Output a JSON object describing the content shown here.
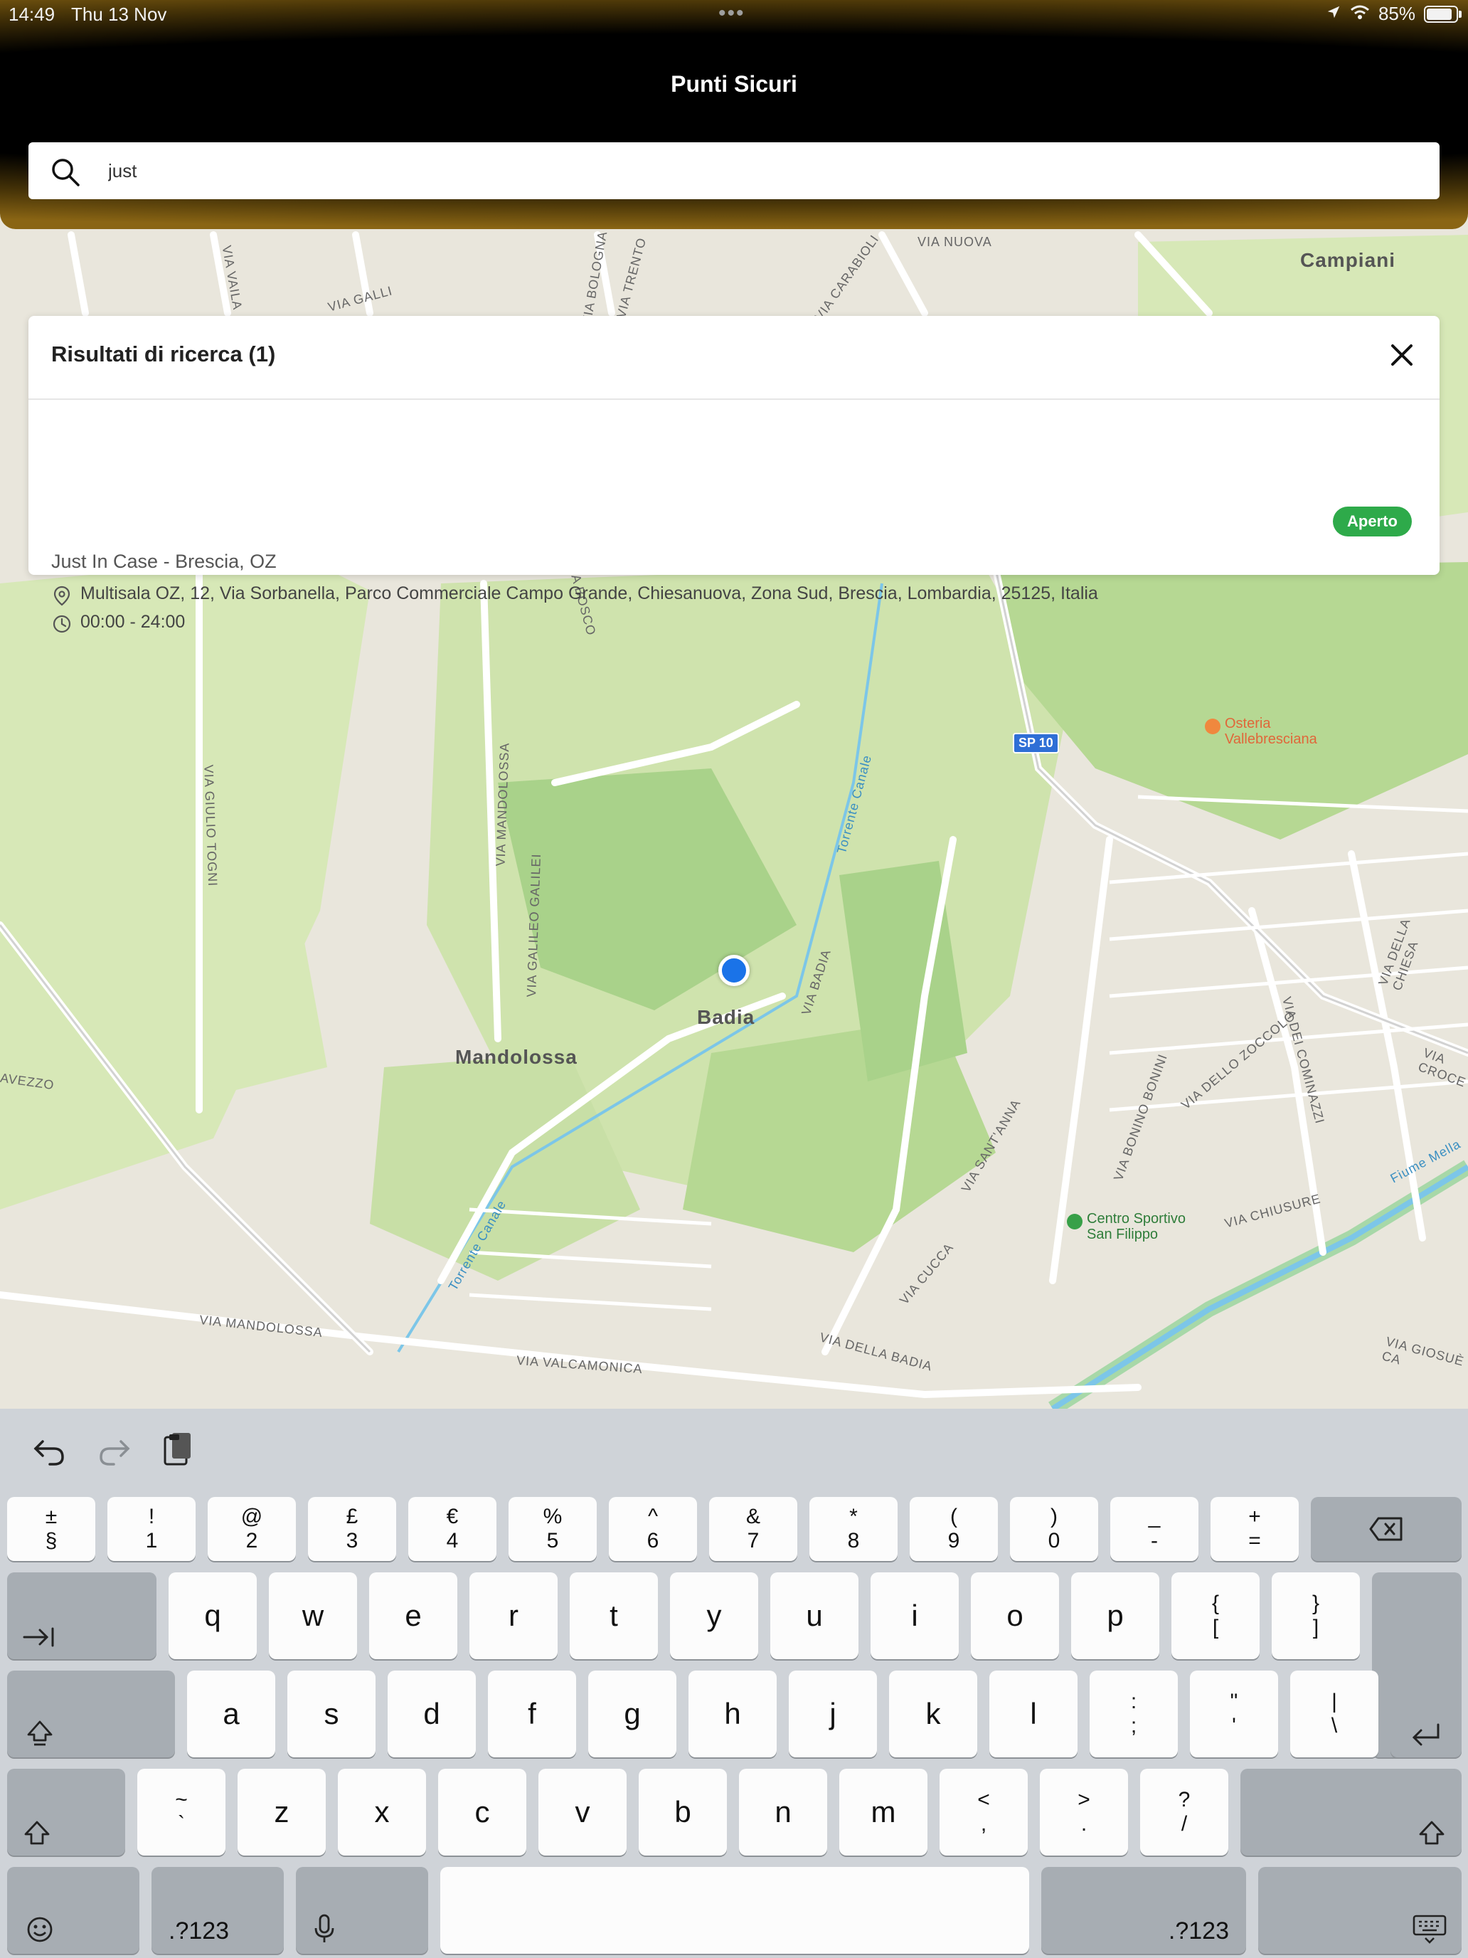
{
  "status_bar": {
    "time": "14:49",
    "date": "Thu 13 Nov",
    "battery": "85%"
  },
  "header": {
    "title": "Punti Sicuri"
  },
  "search": {
    "value": "just"
  },
  "results": {
    "title": "Risultati di ricerca (1)",
    "items": [
      {
        "status": "Aperto",
        "name": "Just In Case - Brescia, OZ",
        "address": "Multisala OZ, 12, Via Sorbanella, Parco Commerciale Campo Grande, Chiesanuova, Zona Sud, Brescia, Lombardia, 25125, Italia",
        "hours": "00:00 - 24:00"
      }
    ]
  },
  "map": {
    "places": [
      "Campiani",
      "Badia",
      "Mandolossa"
    ],
    "pois": [
      "Osteria\nVallebresciana",
      "Centro Sportivo\nSan Filippo"
    ],
    "shields": [
      "SP 10"
    ],
    "roads": [
      "VIA NUOVA",
      "VIA CARABIOLI",
      "VIA GALLI",
      "VIA MANDOLOSSA",
      "VIA GIULIO TOGNI",
      "VIA GALILEO GALILEI",
      "VIA BADIA",
      "Torrente Canale",
      "VIA MANDOLOSSA",
      "VIA VALCAMONICA",
      "VIA DELLA BADIA",
      "VIA CUCCA",
      "VIA SANT'ANNA",
      "VIA BONINO BONINI",
      "VIA DELLO ZOCCOLO",
      "VIA DEI COMINAZZI",
      "VIA DELLA CHIESA",
      "VIA CHIUSURE",
      "VIA CROCE",
      "Fiume Mella",
      "VIA GIOSUÈ CA",
      "Torrente Canale",
      "VIA VAILA",
      "VIA BOLOGNA",
      "VIA TRENTO",
      "AVEZZO",
      "A BOSCO"
    ],
    "colors": {
      "base": "#e9e6dc",
      "green": "#cfe3ad",
      "green_dark": "#a9d28a",
      "road": "#ffffff",
      "water": "#7cc6e8"
    }
  },
  "keyboard": {
    "row1": [
      [
        "±",
        "§"
      ],
      [
        "!",
        "1"
      ],
      [
        "@",
        "2"
      ],
      [
        "£",
        "3"
      ],
      [
        "€",
        "4"
      ],
      [
        "%",
        "5"
      ],
      [
        "^",
        "6"
      ],
      [
        "&",
        "7"
      ],
      [
        "*",
        "8"
      ],
      [
        "(",
        "9"
      ],
      [
        ")",
        "0"
      ],
      [
        "_",
        "-"
      ],
      [
        "+",
        "="
      ]
    ],
    "row2": [
      "q",
      "w",
      "e",
      "r",
      "t",
      "y",
      "u",
      "i",
      "o",
      "p"
    ],
    "row2_extra": [
      [
        "{",
        "["
      ],
      [
        "}",
        "]"
      ]
    ],
    "row3": [
      "a",
      "s",
      "d",
      "f",
      "g",
      "h",
      "j",
      "k",
      "l"
    ],
    "row3_extra": [
      [
        ":",
        ";"
      ],
      [
        "\"",
        "'"
      ],
      [
        "|",
        "\\"
      ]
    ],
    "row4_first": [
      "~",
      "`"
    ],
    "row4": [
      "z",
      "x",
      "c",
      "v",
      "b",
      "n",
      "m"
    ],
    "row4_extra": [
      [
        "<",
        ","
      ],
      [
        ">",
        "."
      ],
      [
        "?",
        "/"
      ]
    ],
    "numbers_label": ".?123"
  }
}
